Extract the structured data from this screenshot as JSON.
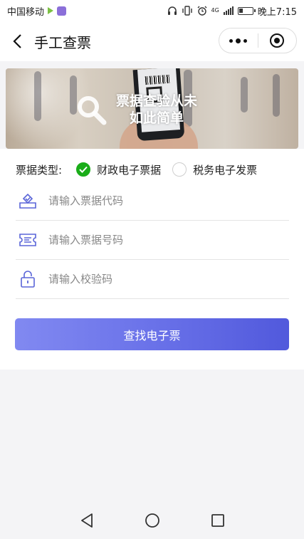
{
  "status_bar": {
    "carrier": "中国移动",
    "time": "晚上7:15",
    "network": "4G"
  },
  "nav": {
    "title": "手工查票"
  },
  "banner": {
    "text_line1": "票据查验从未",
    "text_line2": "如此简单"
  },
  "form": {
    "type_label": "票据类型:",
    "options": [
      {
        "label": "财政电子票据",
        "checked": true
      },
      {
        "label": "税务电子发票",
        "checked": false
      }
    ],
    "fields": [
      {
        "placeholder": "请输入票据代码",
        "icon": "ticket-stamp-icon"
      },
      {
        "placeholder": "请输入票据号码",
        "icon": "ticket-number-icon"
      },
      {
        "placeholder": "请输入校验码",
        "icon": "lock-icon"
      }
    ],
    "submit_label": "查找电子票"
  },
  "colors": {
    "accent": "#6a72e9",
    "checked": "#1aad19",
    "icon": "#5a65d8"
  }
}
